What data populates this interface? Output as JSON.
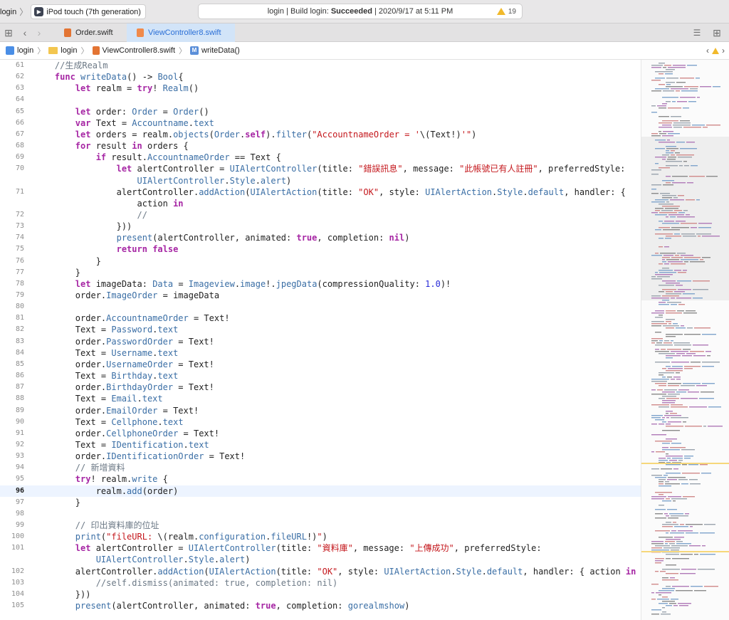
{
  "toolbar": {
    "scheme_label": "login",
    "device_label": "iPod touch (7th generation)",
    "status_project": "login",
    "status_prefix": "Build login:",
    "status_result": "Succeeded",
    "status_time": "2020/9/17 at 5:11 PM",
    "warning_count": "19"
  },
  "tabs": [
    {
      "label": "Order.swift",
      "active": false
    },
    {
      "label": "ViewController8.swift",
      "active": true
    }
  ],
  "jumpbar": {
    "items": [
      "login",
      "login",
      "ViewController8.swift",
      "writeData()"
    ]
  },
  "editor": {
    "current_line": "96",
    "lines": [
      {
        "n": "61",
        "html": "    <span class=\"c\">//生成Realm</span>"
      },
      {
        "n": "62",
        "html": "    <span class=\"k\">func</span> <span class=\"t\">writeData</span>() -> <span class=\"t\">Bool</span>{"
      },
      {
        "n": "63",
        "html": "        <span class=\"k\">let</span> realm = <span class=\"k\">try</span>! <span class=\"t\">Realm</span>()"
      },
      {
        "n": "64",
        "html": ""
      },
      {
        "n": "65",
        "html": "        <span class=\"k\">let</span> order: <span class=\"t\">Order</span> = <span class=\"t\">Order</span>()"
      },
      {
        "n": "66",
        "html": "        <span class=\"k\">var</span> Text = <span class=\"t\">Accountname</span>.<span class=\"t\">text</span>"
      },
      {
        "n": "67",
        "html": "        <span class=\"k\">let</span> orders = realm.<span class=\"t\">objects</span>(<span class=\"t\">Order</span>.<span class=\"k\">self</span>).<span class=\"t\">filter</span>(<span class=\"s\">\"AccountnameOrder = '</span>\\(Text!)<span class=\"s\">'\"</span>)"
      },
      {
        "n": "68",
        "html": "        <span class=\"k\">for</span> result <span class=\"k\">in</span> orders {"
      },
      {
        "n": "69",
        "html": "            <span class=\"k\">if</span> result.<span class=\"t\">AccountnameOrder</span> == Text {"
      },
      {
        "n": "70",
        "html": "                <span class=\"k\">let</span> alertController = <span class=\"t\">UIAlertController</span>(title: <span class=\"s\">\"錯誤訊息\"</span>, message: <span class=\"s\">\"此帳號已有人註冊\"</span>, preferredStyle:"
      },
      {
        "n": "",
        "html": "                    <span class=\"t\">UIAlertController</span>.<span class=\"t\">Style</span>.<span class=\"t\">alert</span>)"
      },
      {
        "n": "71",
        "html": "                alertController.<span class=\"t\">addAction</span>(<span class=\"t\">UIAlertAction</span>(title: <span class=\"s\">\"OK\"</span>, style: <span class=\"t\">UIAlertAction</span>.<span class=\"t\">Style</span>.<span class=\"t\">default</span>, handler: {"
      },
      {
        "n": "",
        "html": "                    action <span class=\"k\">in</span>"
      },
      {
        "n": "72",
        "html": "                    <span class=\"c\">//</span>"
      },
      {
        "n": "73",
        "html": "                }))"
      },
      {
        "n": "74",
        "html": "                <span class=\"t\">present</span>(alertController, animated: <span class=\"k\">true</span>, completion: <span class=\"k\">nil</span>)"
      },
      {
        "n": "75",
        "html": "                <span class=\"k\">return</span> <span class=\"k\">false</span>"
      },
      {
        "n": "76",
        "html": "            }"
      },
      {
        "n": "77",
        "html": "        }"
      },
      {
        "n": "78",
        "html": "        <span class=\"k\">let</span> imageData: <span class=\"t\">Data</span> = <span class=\"t\">Imageview</span>.<span class=\"t\">image</span>!.<span class=\"t\">jpegData</span>(compressionQuality: <span class=\"n\">1.0</span>)!"
      },
      {
        "n": "79",
        "html": "        order.<span class=\"t\">ImageOrder</span> = imageData"
      },
      {
        "n": "80",
        "html": ""
      },
      {
        "n": "81",
        "html": "        order.<span class=\"t\">AccountnameOrder</span> = Text!"
      },
      {
        "n": "82",
        "html": "        Text = <span class=\"t\">Password</span>.<span class=\"t\">text</span>"
      },
      {
        "n": "83",
        "html": "        order.<span class=\"t\">PasswordOrder</span> = Text!"
      },
      {
        "n": "84",
        "html": "        Text = <span class=\"t\">Username</span>.<span class=\"t\">text</span>"
      },
      {
        "n": "85",
        "html": "        order.<span class=\"t\">UsernameOrder</span> = Text!"
      },
      {
        "n": "86",
        "html": "        Text = <span class=\"t\">Birthday</span>.<span class=\"t\">text</span>"
      },
      {
        "n": "87",
        "html": "        order.<span class=\"t\">BirthdayOrder</span> = Text!"
      },
      {
        "n": "88",
        "html": "        Text = <span class=\"t\">Email</span>.<span class=\"t\">text</span>"
      },
      {
        "n": "89",
        "html": "        order.<span class=\"t\">EmailOrder</span> = Text!"
      },
      {
        "n": "90",
        "html": "        Text = <span class=\"t\">Cellphone</span>.<span class=\"t\">text</span>"
      },
      {
        "n": "91",
        "html": "        order.<span class=\"t\">CellphoneOrder</span> = Text!"
      },
      {
        "n": "92",
        "html": "        Text = <span class=\"t\">IDentification</span>.<span class=\"t\">text</span>"
      },
      {
        "n": "93",
        "html": "        order.<span class=\"t\">IDentificationOrder</span> = Text!"
      },
      {
        "n": "94",
        "html": "        <span class=\"c\">// 新增資料</span>"
      },
      {
        "n": "95",
        "html": "        <span class=\"k\">try</span>! realm.<span class=\"t\">write</span> {"
      },
      {
        "n": "96",
        "html": "            realm.<span class=\"t\">add</span>(order)"
      },
      {
        "n": "97",
        "html": "        }"
      },
      {
        "n": "98",
        "html": ""
      },
      {
        "n": "99",
        "html": "        <span class=\"c\">// 印出資料庫的位址</span>"
      },
      {
        "n": "100",
        "html": "        <span class=\"t\">print</span>(<span class=\"s\">\"fileURL: </span>\\(realm.<span class=\"t\">configuration</span>.<span class=\"t\">fileURL</span>!)<span class=\"s\">\"</span>)"
      },
      {
        "n": "101",
        "html": "        <span class=\"k\">let</span> alertController = <span class=\"t\">UIAlertController</span>(title: <span class=\"s\">\"資料庫\"</span>, message: <span class=\"s\">\"上傳成功\"</span>, preferredStyle:"
      },
      {
        "n": "",
        "html": "            <span class=\"t\">UIAlertController</span>.<span class=\"t\">Style</span>.<span class=\"t\">alert</span>)"
      },
      {
        "n": "102",
        "html": "        alertController.<span class=\"t\">addAction</span>(<span class=\"t\">UIAlertAction</span>(title: <span class=\"s\">\"OK\"</span>, style: <span class=\"t\">UIAlertAction</span>.<span class=\"t\">Style</span>.<span class=\"t\">default</span>, handler: { action <span class=\"k\">in</span>"
      },
      {
        "n": "103",
        "html": "            <span class=\"c\">//self.dismiss(animated: true, completion: nil)</span>"
      },
      {
        "n": "104",
        "html": "        }))"
      },
      {
        "n": "105",
        "html": "        <span class=\"t\">present</span>(alertController, animated: <span class=\"k\">true</span>, completion: <span class=\"t\">gorealmshow</span>)"
      }
    ]
  },
  "colors": {
    "keyword": "#a626a4",
    "string": "#c4171c",
    "type": "#3a6ea5",
    "comment": "#6c7986",
    "number": "#272ad8",
    "active_tab_bg": "#d2e4f8",
    "active_tab_text": "#2b6fd6",
    "warning": "#f1b92b"
  },
  "icons": [
    "grid-icon",
    "back-chevron-icon",
    "forward-chevron-icon",
    "swift-file-icon",
    "project-icon",
    "folder-icon",
    "method-icon",
    "warning-icon",
    "editor-options-icon",
    "add-editor-icon",
    "device-icon"
  ]
}
